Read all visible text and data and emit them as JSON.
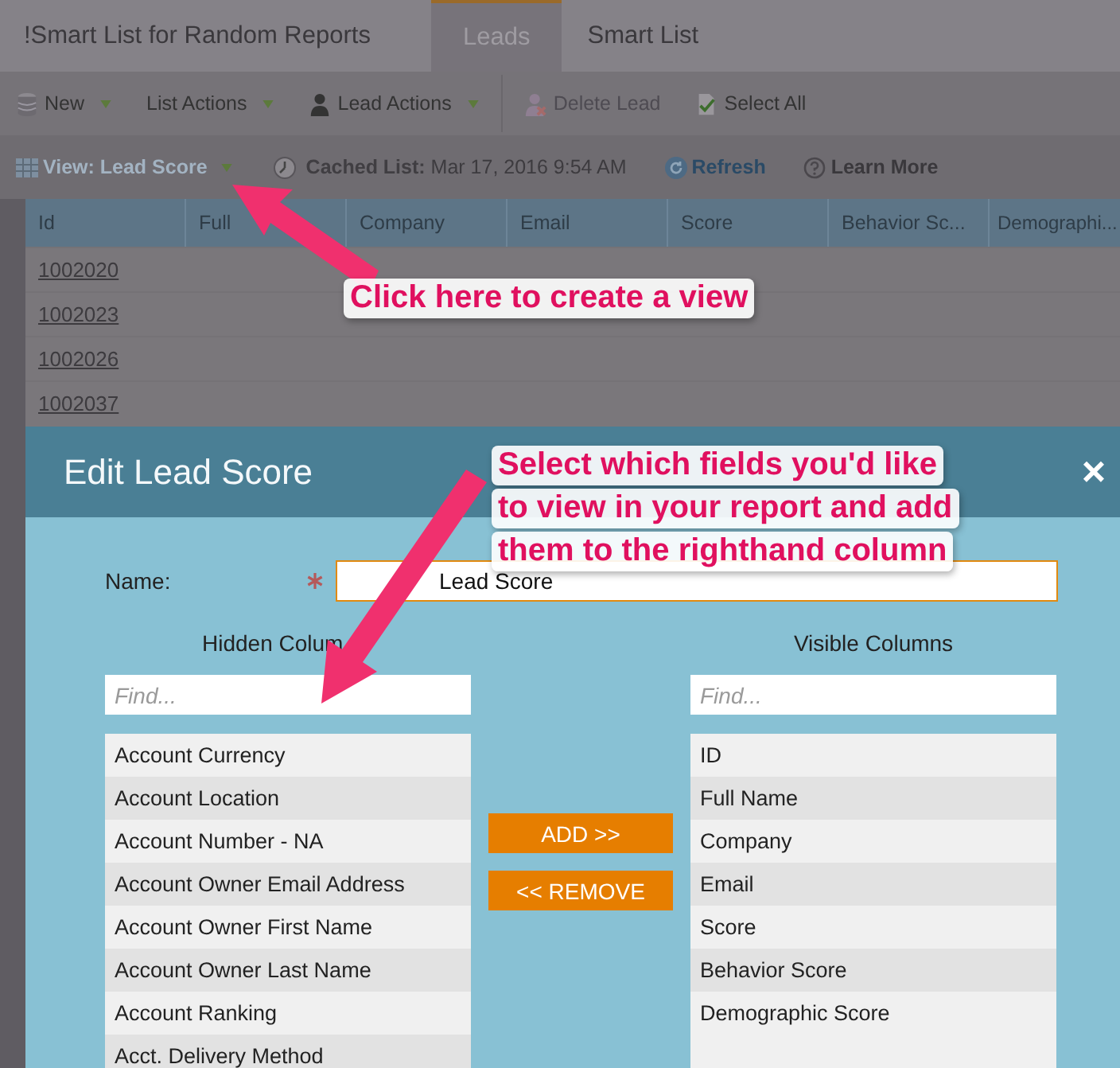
{
  "tabs": [
    {
      "label": "!Smart List for Random Reports",
      "selected": false
    },
    {
      "label": "Leads",
      "selected": true
    },
    {
      "label": "Smart List",
      "selected": false
    }
  ],
  "toolbar": [
    {
      "label": "New",
      "disabled": false,
      "dropdown": true
    },
    {
      "label": "List Actions",
      "disabled": false,
      "dropdown": true
    },
    {
      "label": "Lead Actions",
      "disabled": false,
      "dropdown": true
    },
    {
      "label": "Delete Lead",
      "disabled": true,
      "dropdown": false
    },
    {
      "label": "Select All",
      "disabled": false,
      "dropdown": false
    }
  ],
  "view_bar": {
    "view": "View: Lead Score",
    "cached_label": "Cached List:",
    "cached_value": "Mar 17, 2016 9:54 AM",
    "refresh": "Refresh",
    "learn_more": "Learn More"
  },
  "table": {
    "columns": [
      "Id",
      "Full",
      "Company",
      "Email",
      "Score",
      "Behavior Sc...",
      "Demographi..."
    ],
    "rows": [
      "1002020",
      "1002023",
      "1002026",
      "1002037"
    ]
  },
  "dialog": {
    "title": "Edit Lead Score",
    "name_label": "Name:",
    "name_value": "Lead Score",
    "hidden": {
      "heading": "Hidden Colum",
      "placeholder": "Find...",
      "items": [
        "Account Currency",
        "Account Location",
        "Account Number - NA",
        "Account Owner Email Address",
        "Account Owner First Name",
        "Account Owner Last Name",
        "Account Ranking",
        "Acct. Delivery Method"
      ]
    },
    "visible": {
      "heading": "Visible Columns",
      "placeholder": "Find...",
      "items": [
        "ID",
        "Full Name",
        "Company",
        "Email",
        "Score",
        "Behavior Score",
        "Demographic Score"
      ]
    },
    "add": "ADD >>",
    "remove": "<< REMOVE",
    "close": "×"
  },
  "annotations": [
    {
      "lines": [
        "Click here to create a view"
      ]
    },
    {
      "lines": [
        "Select which fields you'd like",
        "to view in your report and add",
        "them to the righthand column"
      ]
    }
  ]
}
